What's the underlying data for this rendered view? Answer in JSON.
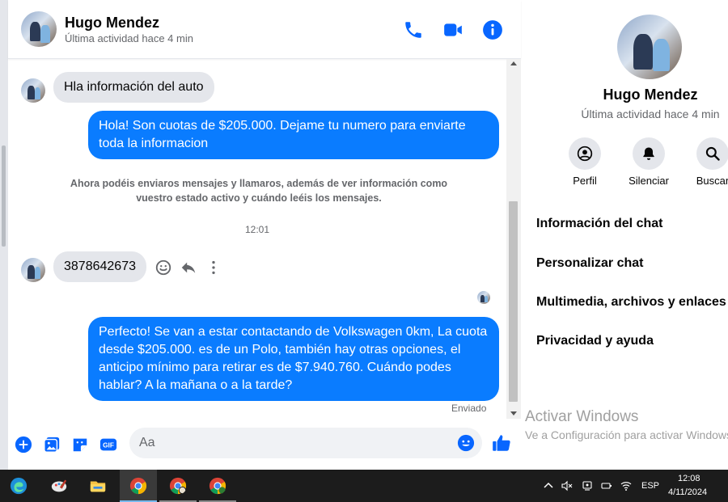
{
  "header": {
    "name": "Hugo Mendez",
    "status": "Última actividad hace 4 min"
  },
  "messages": {
    "incoming_1": "Hla información del auto",
    "outgoing_1": "Hola! Son cuotas de $205.000. Dejame tu numero para enviarte toda la informacion",
    "notice": "Ahora podéis enviaros mensajes y llamaros, además de ver información como vuestro estado activo y cuándo leéis los mensajes.",
    "timestamp": "12:01",
    "incoming_2": "3878642673",
    "outgoing_2": "Perfecto!  Se van a estar contactando de Volkswagen 0km, La cuota desde $205.000. es de un Polo, también hay otras opciones, el anticipo mínimo para retirar es de $7.940.760. Cuándo podes hablar? A la mañana o a la tarde?",
    "sent_status": "Enviado"
  },
  "composer": {
    "placeholder": "Aa"
  },
  "info_panel": {
    "name": "Hugo Mendez",
    "status": "Última actividad hace 4 min",
    "actions": [
      {
        "label": "Perfil",
        "icon": "profile-icon"
      },
      {
        "label": "Silenciar",
        "icon": "bell-icon"
      },
      {
        "label": "Buscar",
        "icon": "search-icon"
      }
    ],
    "menu": [
      "Información del chat",
      "Personalizar chat",
      "Multimedia, archivos y enlaces",
      "Privacidad y ayuda"
    ],
    "watermark_title": "Activar Windows",
    "watermark_sub": "Ve a Configuración para activar Windows."
  },
  "taskbar": {
    "lang": "ESP",
    "time": "12:08",
    "date": "4/11/2024"
  },
  "colors": {
    "accent": "#0a7cff",
    "bubble_in": "#e4e6eb",
    "icon_blue": "#0866ff"
  }
}
